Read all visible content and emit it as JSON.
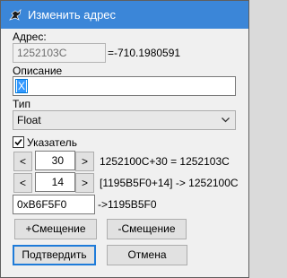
{
  "window": {
    "title": "Изменить адрес"
  },
  "address": {
    "label": "Адрес:",
    "value": "1252103C",
    "result": "=-710.1980591"
  },
  "description": {
    "label": "Описание",
    "value": "X"
  },
  "type": {
    "label": "Тип",
    "selected": "Float"
  },
  "pointer": {
    "label": "Указатель",
    "checked": true
  },
  "offsets": [
    {
      "dec": "<",
      "value": "30",
      "inc": ">",
      "text": "1252100C+30 = 1252103C"
    },
    {
      "dec": "<",
      "value": "14",
      "inc": ">",
      "text": "[1195B5F0+14] -> 1252100C"
    }
  ],
  "base": {
    "value": "0xB6F5F0",
    "text": "->1195B5F0"
  },
  "buttons": {
    "add_offset": "+Смещение",
    "remove_offset": "-Смещение",
    "confirm": "Подтвердить",
    "cancel": "Отмена"
  }
}
